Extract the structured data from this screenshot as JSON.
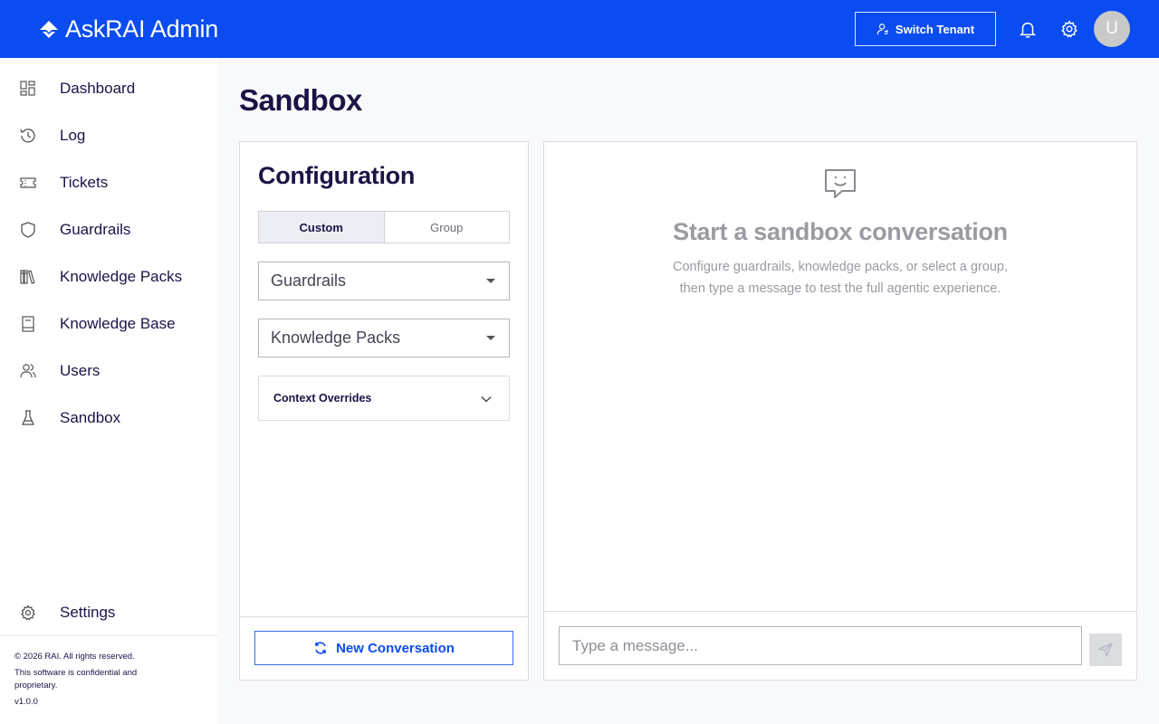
{
  "header": {
    "brand": "AskRAI Admin",
    "switch_tenant_label": "Switch Tenant",
    "avatar_initial": "U",
    "accent_color": "#0a4cf0"
  },
  "sidebar": {
    "items": [
      {
        "label": "Dashboard",
        "icon": "dashboard-icon"
      },
      {
        "label": "Log",
        "icon": "history-icon"
      },
      {
        "label": "Tickets",
        "icon": "ticket-icon"
      },
      {
        "label": "Guardrails",
        "icon": "shield-icon"
      },
      {
        "label": "Knowledge Packs",
        "icon": "books-icon"
      },
      {
        "label": "Knowledge Base",
        "icon": "book-icon"
      },
      {
        "label": "Users",
        "icon": "users-icon"
      },
      {
        "label": "Sandbox",
        "icon": "flask-icon"
      }
    ],
    "settings_label": "Settings",
    "footer": {
      "copyright": "© 2026 RAI. All rights reserved.",
      "confidential": "This software is confidential and proprietary.",
      "version": "v1.0.0"
    }
  },
  "page": {
    "title": "Sandbox"
  },
  "config": {
    "title": "Configuration",
    "tabs": [
      "Custom",
      "Group"
    ],
    "active_tab": "Custom",
    "guardrails_placeholder": "Guardrails",
    "knowledge_packs_placeholder": "Knowledge Packs",
    "context_overrides_label": "Context Overrides",
    "new_conversation_label": "New Conversation"
  },
  "chat": {
    "empty_title": "Start a sandbox conversation",
    "empty_description": "Configure guardrails, knowledge packs, or select a group, then type a message to test the full agentic experience.",
    "input_placeholder": "Type a message..."
  }
}
